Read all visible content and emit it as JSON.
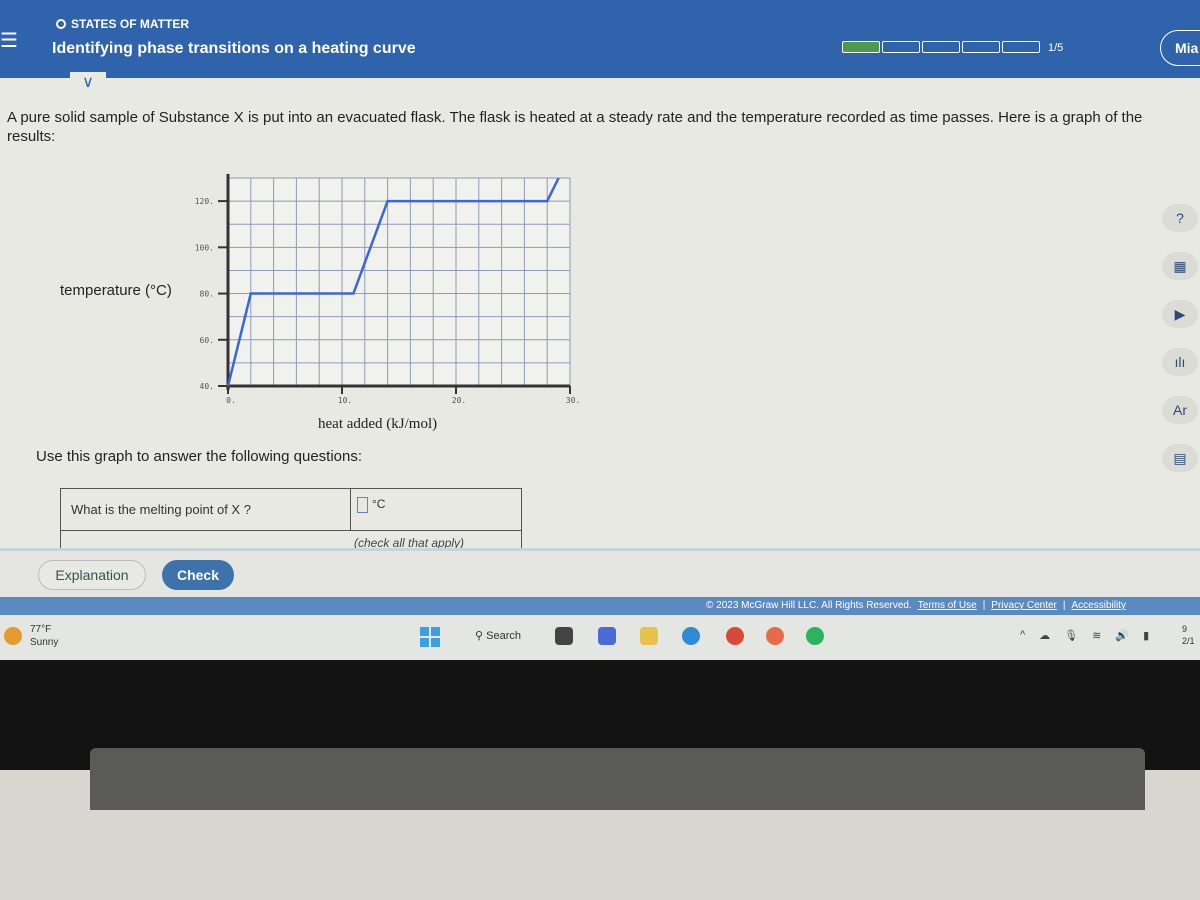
{
  "header": {
    "topic": "STATES OF MATTER",
    "title": "Identifying phase transitions on a heating curve",
    "progress": {
      "current": 1,
      "total": 5,
      "label": "1/5"
    },
    "user": "Mia"
  },
  "intro": "A pure solid sample of Substance X is put into an evacuated flask. The flask is heated at a steady rate and the temperature recorded as time passes. Here is a graph of the results:",
  "chart_data": {
    "type": "line",
    "xlabel": "heat added (kJ/mol)",
    "ylabel": "temperature (°C)",
    "xlim": [
      0,
      30
    ],
    "ylim": [
      40,
      130
    ],
    "xticks": [
      "0.",
      "10.",
      "20.",
      "30."
    ],
    "yticks": [
      "40.",
      "60.",
      "80.",
      "100.",
      "120."
    ],
    "grid": true,
    "line_color": "#3a66d8",
    "x": [
      0,
      2,
      11,
      14,
      28,
      29
    ],
    "y": [
      40,
      80,
      80,
      120,
      120,
      130
    ]
  },
  "use_text": "Use this graph to answer the following questions:",
  "question": {
    "text": "What is the melting point of X ?",
    "unit": "°C",
    "value": "",
    "next_hint": "(check all that apply)"
  },
  "buttons": {
    "explanation": "Explanation",
    "check": "Check"
  },
  "footer": {
    "copyright": "© 2023 McGraw Hill LLC. All Rights Reserved.",
    "terms": "Terms of Use",
    "privacy": "Privacy Center",
    "accessibility": "Accessibility"
  },
  "rail": [
    {
      "icon": "help-icon",
      "glyph": "?"
    },
    {
      "icon": "calculator-icon",
      "glyph": "▦"
    },
    {
      "icon": "video-icon",
      "glyph": "▶"
    },
    {
      "icon": "chart-icon",
      "glyph": "ılı"
    },
    {
      "icon": "periodic-table-icon",
      "glyph": "Ar"
    },
    {
      "icon": "reference-icon",
      "glyph": "▤"
    }
  ],
  "taskbar": {
    "temp": "77°F",
    "weather": "Sunny",
    "search": "Search",
    "time": "9",
    "date": "2/1"
  }
}
